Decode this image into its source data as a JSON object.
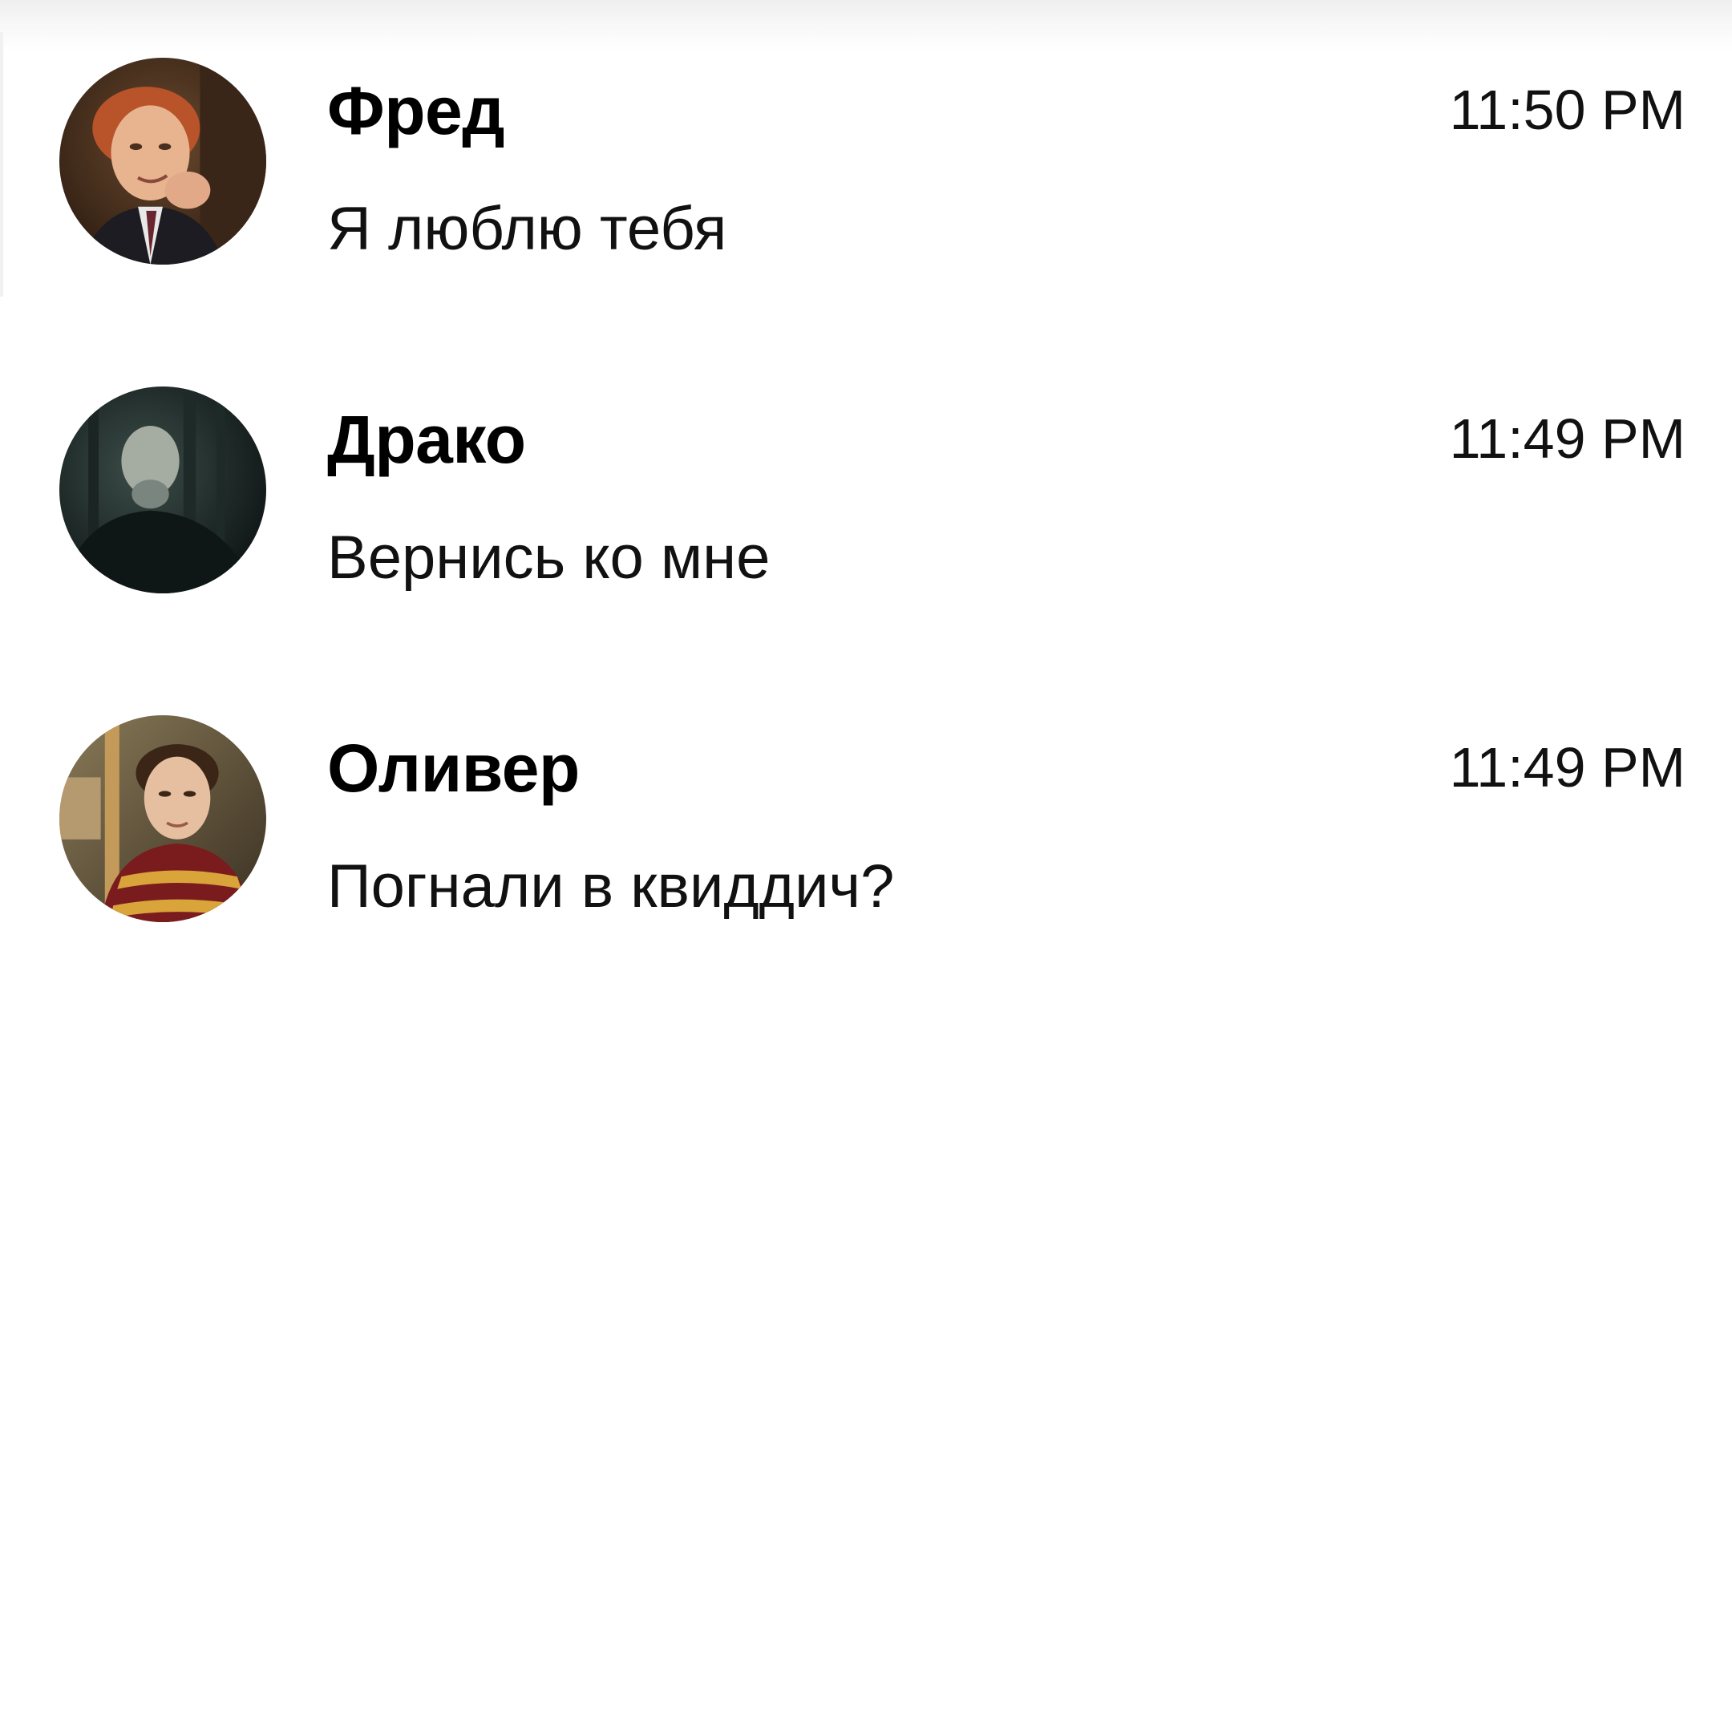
{
  "chats": [
    {
      "name": "Фред",
      "message": "Я люблю тебя",
      "time": "11:50 PM",
      "avatar": "avatar-photo-ginger-boy"
    },
    {
      "name": "Драко",
      "message": "Вернись ко мне",
      "time": "11:49 PM",
      "avatar": "avatar-photo-dark-blond-back"
    },
    {
      "name": "Оливер",
      "message": "Погнали в квиддич?",
      "time": "11:49 PM",
      "avatar": "avatar-photo-quidditch-player"
    }
  ],
  "colors": {
    "background": "#ffffff",
    "text": "#000000"
  }
}
